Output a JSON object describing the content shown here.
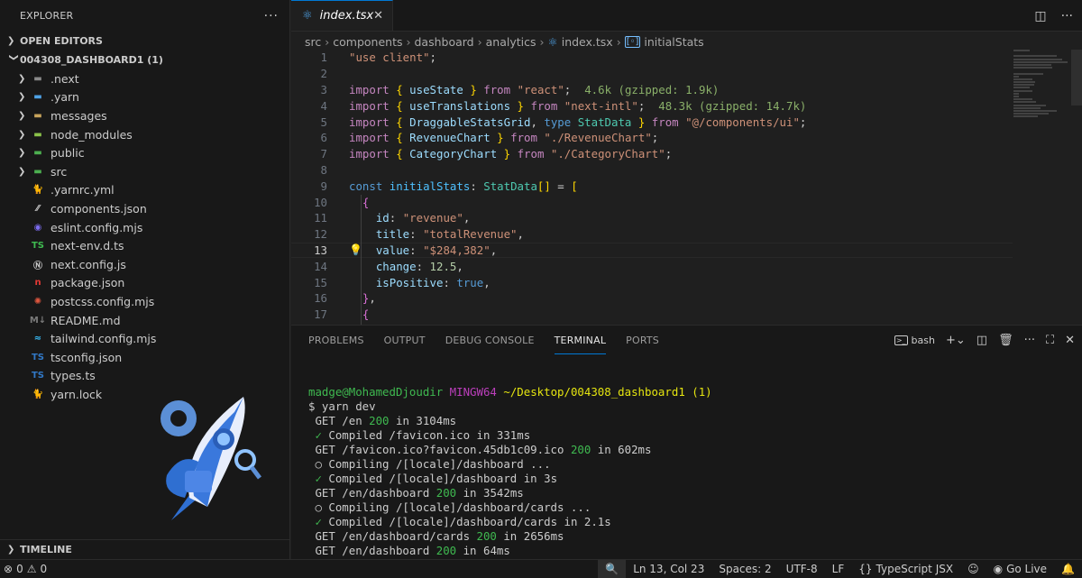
{
  "sidebar": {
    "title": "EXPLORER",
    "open_editors": "OPEN EDITORS",
    "project": "004308_DASHBOARD1 (1)",
    "folders": [
      {
        "name": ".next",
        "icon": "next-folder-icon",
        "color": "#8a8a8a"
      },
      {
        "name": ".yarn",
        "icon": "yarn-folder-icon",
        "color": "#4ea2e6"
      },
      {
        "name": "messages",
        "icon": "folder-icon",
        "color": "#c8a45c"
      },
      {
        "name": "node_modules",
        "icon": "node-folder-icon",
        "color": "#8bc34a"
      },
      {
        "name": "public",
        "icon": "public-folder-icon",
        "color": "#4caf50"
      },
      {
        "name": "src",
        "icon": "src-folder-icon",
        "color": "#4caf50"
      }
    ],
    "files": [
      {
        "name": ".yarnrc.yml",
        "icon": "yarn-icon",
        "glyph": "🐈",
        "color": "#4ea2e6"
      },
      {
        "name": "components.json",
        "icon": "json-icon",
        "glyph": "⁄⁄",
        "color": "#cccccc"
      },
      {
        "name": "eslint.config.mjs",
        "icon": "eslint-icon",
        "glyph": "◉",
        "color": "#7c6cf0"
      },
      {
        "name": "next-env.d.ts",
        "icon": "ts-icon",
        "glyph": "TS",
        "color": "#3fb950"
      },
      {
        "name": "next.config.js",
        "icon": "next-icon",
        "glyph": "Ⓝ",
        "color": "#cccccc"
      },
      {
        "name": "package.json",
        "icon": "npm-icon",
        "glyph": "n",
        "color": "#e53935"
      },
      {
        "name": "postcss.config.mjs",
        "icon": "postcss-icon",
        "glyph": "✺",
        "color": "#e0573f"
      },
      {
        "name": "README.md",
        "icon": "markdown-icon",
        "glyph": "M↓",
        "color": "#7a7a7a"
      },
      {
        "name": "tailwind.config.mjs",
        "icon": "tailwind-icon",
        "glyph": "≈",
        "color": "#38bdf8"
      },
      {
        "name": "tsconfig.json",
        "icon": "tsconfig-icon",
        "glyph": "TS",
        "color": "#3178c6"
      },
      {
        "name": "types.ts",
        "icon": "ts-icon",
        "glyph": "TS",
        "color": "#3178c6"
      },
      {
        "name": "yarn.lock",
        "icon": "yarn-icon",
        "glyph": "🐈",
        "color": "#4ea2e6"
      }
    ],
    "timeline": "TIMELINE"
  },
  "editor": {
    "tab": "index.tsx",
    "breadcrumb": [
      "src",
      "components",
      "dashboard",
      "analytics",
      "index.tsx",
      "initialStats"
    ],
    "line_numbers": [
      "1",
      "2",
      "3",
      "4",
      "5",
      "6",
      "7",
      "8",
      "9",
      "10",
      "11",
      "12",
      "13",
      "14",
      "15",
      "16",
      "17"
    ],
    "current_line": "13"
  },
  "panel": {
    "tabs": [
      "PROBLEMS",
      "OUTPUT",
      "DEBUG CONSOLE",
      "TERMINAL",
      "PORTS"
    ],
    "active_tab": "TERMINAL",
    "shell": "bash",
    "prompt_user": "madge@MohamedDjoudir",
    "prompt_host": "MINGW64",
    "prompt_path": "~/Desktop/004308_dashboard1 (1)",
    "command": "$ yarn dev",
    "output": [
      {
        "pre": " GET /en ",
        "code": "200",
        "post": " in 3104ms",
        "kind": "get"
      },
      {
        "pre": " ✓ ",
        "code": "",
        "post": "Compiled /favicon.ico in 331ms",
        "kind": "ok"
      },
      {
        "pre": " GET /favicon.ico?favicon.45db1c09.ico ",
        "code": "200",
        "post": " in 602ms",
        "kind": "get"
      },
      {
        "pre": " ○ Compiling /[locale]/dashboard ...",
        "code": "",
        "post": "",
        "kind": "plain"
      },
      {
        "pre": " ✓ ",
        "code": "",
        "post": "Compiled /[locale]/dashboard in 3s",
        "kind": "ok"
      },
      {
        "pre": " GET /en/dashboard ",
        "code": "200",
        "post": " in 3542ms",
        "kind": "get"
      },
      {
        "pre": " ○ Compiling /[locale]/dashboard/cards ...",
        "code": "",
        "post": "",
        "kind": "plain"
      },
      {
        "pre": " ✓ ",
        "code": "",
        "post": "Compiled /[locale]/dashboard/cards in 2.1s",
        "kind": "ok"
      },
      {
        "pre": " GET /en/dashboard/cards ",
        "code": "200",
        "post": " in 2656ms",
        "kind": "get"
      },
      {
        "pre": " GET /en/dashboard ",
        "code": "200",
        "post": " in 64ms",
        "kind": "get"
      }
    ]
  },
  "status": {
    "errors": "0",
    "warnings": "0",
    "position": "Ln 13, Col 23",
    "spaces": "Spaces: 2",
    "encoding": "UTF-8",
    "eol": "LF",
    "language": "TypeScript JSX",
    "golive": "Go Live"
  }
}
